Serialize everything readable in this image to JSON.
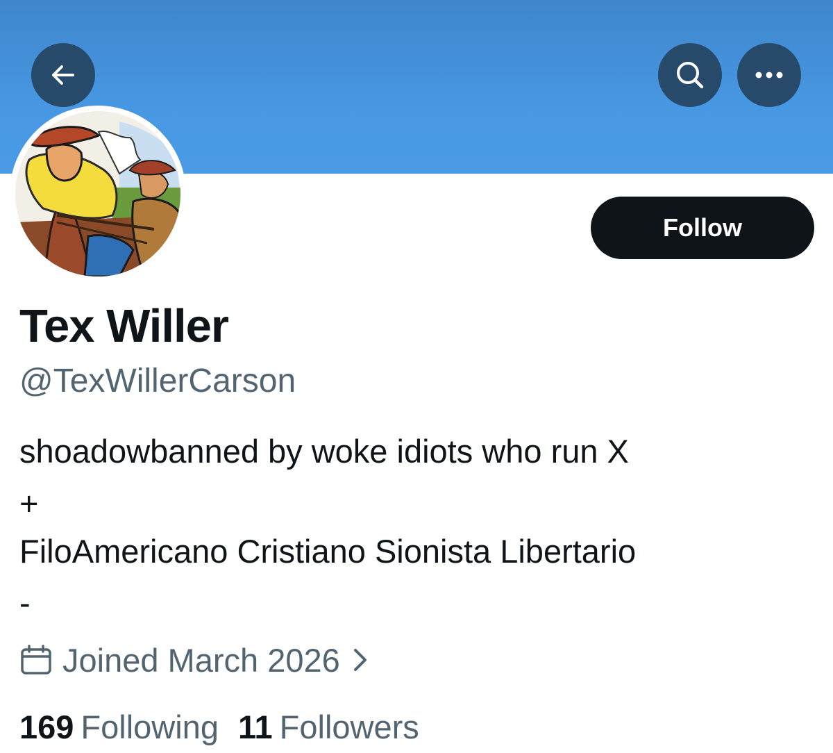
{
  "header": {
    "back_icon": "arrow-left-icon",
    "search_icon": "search-icon",
    "more_icon": "more-horizontal-icon",
    "banner_color": "#4797e2",
    "button_color": "#274a6b"
  },
  "profile": {
    "display_name": "Tex Willer",
    "handle": "@TexWillerCarson",
    "follow_label": "Follow",
    "bio": [
      "shoadowbanned by woke idiots who run X",
      "+",
      "FiloAmericano Cristiano Sionista Libertario",
      "-"
    ],
    "joined": "Joined March 2026",
    "joined_icon": "calendar-icon",
    "stats": {
      "following_count": "169",
      "following_label": "Following",
      "followers_count": "11",
      "followers_label": "Followers"
    }
  },
  "colors": {
    "text_primary": "#0f1419",
    "text_secondary": "#536471",
    "follow_button": "#0f1419"
  }
}
